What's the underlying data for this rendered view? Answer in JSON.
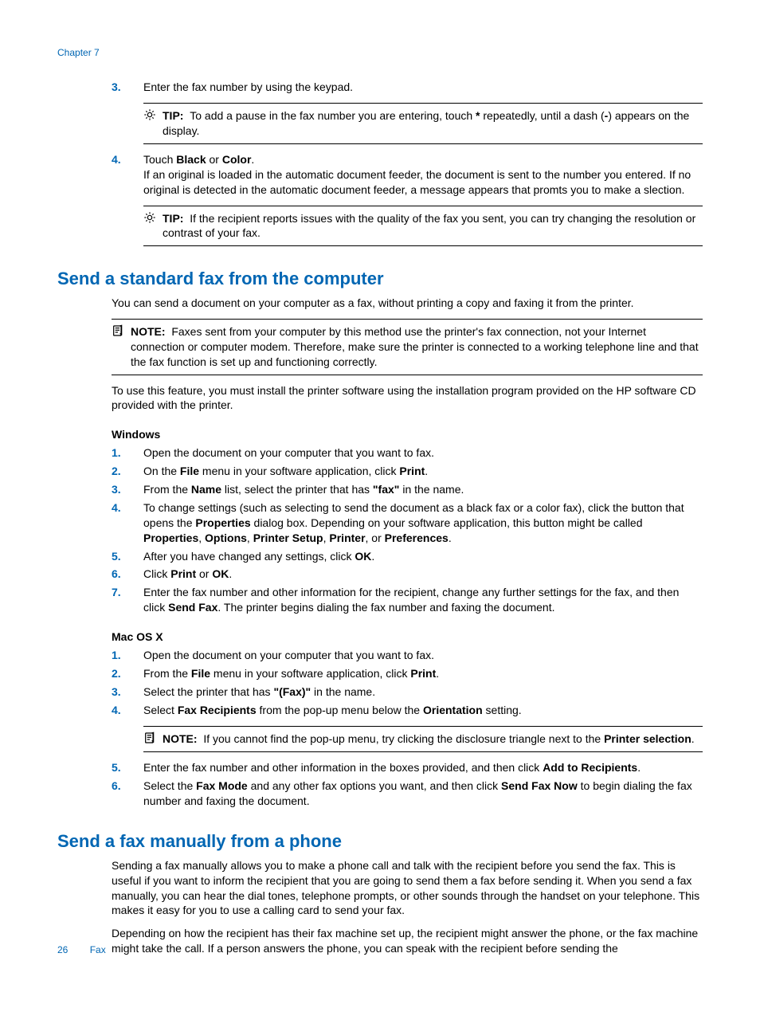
{
  "header": {
    "chapter": "Chapter 7"
  },
  "top_steps_start": 3,
  "step3": "Enter the fax number by using the keypad.",
  "tip1": {
    "label": "TIP:",
    "pre": "To add a pause in the fax number you are entering, touch ",
    "b1": "*",
    "mid": " repeatedly, until a dash (",
    "b2": "-",
    "post": ") appears on the display."
  },
  "step4": {
    "pre": "Touch ",
    "b1": "Black",
    "mid": " or ",
    "b2": "Color",
    "post": ".",
    "desc": "If an original is loaded in the automatic document feeder, the document is sent to the number you entered. If no original is detected in the automatic document feeder, a message appears that promts you to make a slection."
  },
  "tip2": {
    "label": "TIP:",
    "text": "If the recipient reports issues with the quality of the fax you sent, you can try changing the resolution or contrast of your fax."
  },
  "h1": "Send a standard fax from the computer",
  "h1_intro": "You can send a document on your computer as a fax, without printing a copy and faxing it from the printer.",
  "note1": {
    "label": "NOTE:",
    "text": "Faxes sent from your computer by this method use the printer's fax connection, not your Internet connection or computer modem. Therefore, make sure the printer is connected to a working telephone line and that the fax function is set up and functioning correctly."
  },
  "h1_p2": "To use this feature, you must install the printer software using the installation program provided on the HP software CD provided with the printer.",
  "win": {
    "title": "Windows",
    "s1": "Open the document on your computer that you want to fax.",
    "s2": {
      "pre": "On the ",
      "b1": "File",
      "mid": " menu in your software application, click ",
      "b2": "Print",
      "post": "."
    },
    "s3": {
      "pre": "From the ",
      "b1": "Name",
      "mid": " list, select the printer that has ",
      "b2": "\"fax\"",
      "post": " in the name."
    },
    "s4": {
      "pre": "To change settings (such as selecting to send the document as a black fax or a color fax), click the button that opens the ",
      "b1": "Properties",
      "mid": " dialog box. Depending on your software application, this button might be called ",
      "b2": "Properties",
      "c": ", ",
      "b3": "Options",
      "c2": ", ",
      "b4": "Printer Setup",
      "c3": ", ",
      "b5": "Printer",
      "c4": ", or ",
      "b6": "Preferences",
      "post": "."
    },
    "s5": {
      "pre": "After you have changed any settings, click ",
      "b1": "OK",
      "post": "."
    },
    "s6": {
      "pre": "Click ",
      "b1": "Print",
      "mid": " or ",
      "b2": "OK",
      "post": "."
    },
    "s7": {
      "pre": "Enter the fax number and other information for the recipient, change any further settings for the fax, and then click ",
      "b1": "Send Fax",
      "post": ". The printer begins dialing the fax number and faxing the document."
    }
  },
  "mac": {
    "title": "Mac OS X",
    "s1": "Open the document on your computer that you want to fax.",
    "s2": {
      "pre": "From the ",
      "b1": "File",
      "mid": " menu in your software application, click ",
      "b2": "Print",
      "post": "."
    },
    "s3": {
      "pre": "Select the printer that has ",
      "b1": "\"(Fax)\"",
      "post": " in the name."
    },
    "s4": {
      "pre": "Select ",
      "b1": "Fax Recipients",
      "mid": " from the pop-up menu below the ",
      "b2": "Orientation",
      "post": " setting."
    },
    "note": {
      "label": "NOTE:",
      "pre": "If you cannot find the pop-up menu, try clicking the disclosure triangle next to the ",
      "b1": "Printer selection",
      "post": "."
    },
    "s5": {
      "pre": "Enter the fax number and other information in the boxes provided, and then click ",
      "b1": "Add to Recipients",
      "post": "."
    },
    "s6": {
      "pre": "Select the ",
      "b1": "Fax Mode",
      "mid": " and any other fax options you want, and then click ",
      "b2": "Send Fax Now",
      "post": " to begin dialing the fax number and faxing the document."
    }
  },
  "h2": "Send a fax manually from a phone",
  "h2_p1": "Sending a fax manually allows you to make a phone call and talk with the recipient before you send the fax. This is useful if you want to inform the recipient that you are going to send them a fax before sending it. When you send a fax manually, you can hear the dial tones, telephone prompts, or other sounds through the handset on your telephone. This makes it easy for you to use a calling card to send your fax.",
  "h2_p2": "Depending on how the recipient has their fax machine set up, the recipient might answer the phone, or the fax machine might take the call. If a person answers the phone, you can speak with the recipient before sending the",
  "footer": {
    "page": "26",
    "section": "Fax"
  }
}
